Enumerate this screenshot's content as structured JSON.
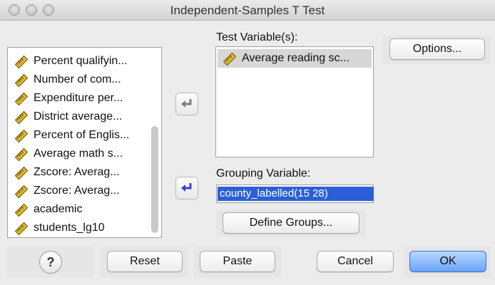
{
  "window": {
    "title": "Independent-Samples T Test"
  },
  "variables": [
    {
      "label": "Percent qualifyin..."
    },
    {
      "label": "Number of com..."
    },
    {
      "label": "Expenditure per..."
    },
    {
      "label": "District average..."
    },
    {
      "label": "Percent of Englis..."
    },
    {
      "label": "Average math s..."
    },
    {
      "label": "Zscore:  Averag..."
    },
    {
      "label": "Zscore:  Averag..."
    },
    {
      "label": "academic"
    },
    {
      "label": "students_lg10"
    }
  ],
  "test_variables": {
    "label": "Test Variable(s):",
    "items": [
      {
        "label": "Average reading sc..."
      }
    ]
  },
  "grouping": {
    "label": "Grouping Variable:",
    "value": "county_labelled(15 28)",
    "define_label": "Define Groups..."
  },
  "buttons": {
    "options": "Options...",
    "help": "?",
    "reset": "Reset",
    "paste": "Paste",
    "cancel": "Cancel",
    "ok": "OK"
  },
  "colors": {
    "selection": "#2b5fd9",
    "default_button": "#6aa4f5",
    "variable_icon": "#e1b82a"
  }
}
